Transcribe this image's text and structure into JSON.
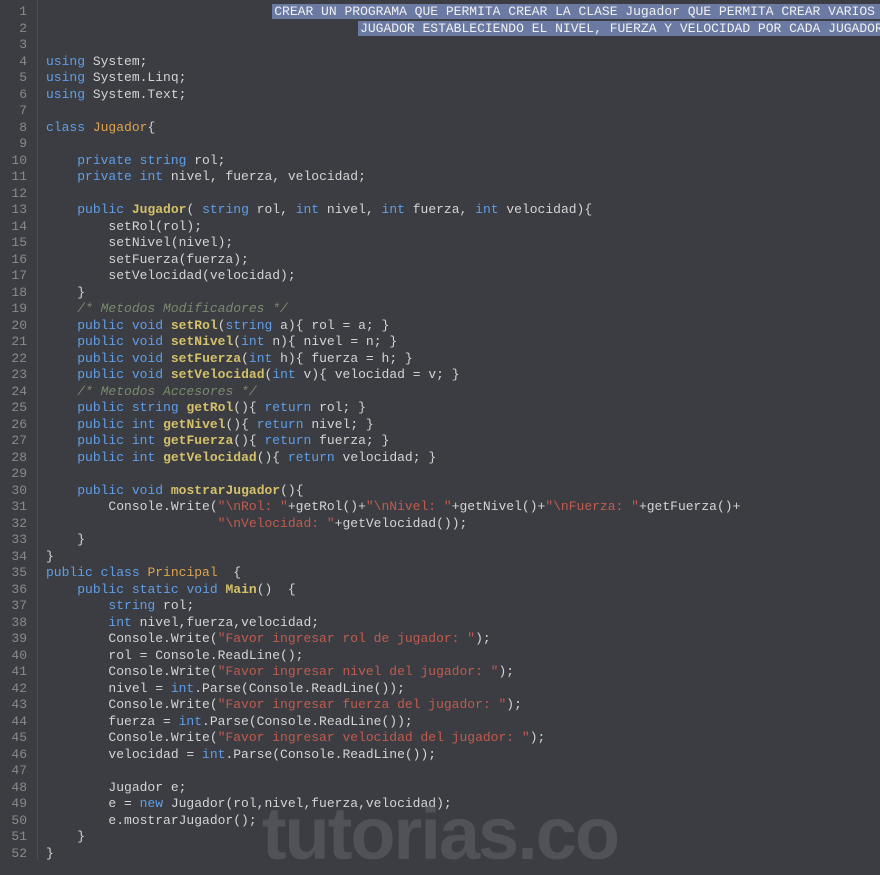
{
  "watermark": "tutorias.co",
  "selection_line1": "CREAR UN PROGRAMA QUE PERMITA CREAR LA CLASE Jugador QUE PERMITA CREAR VARIOS ROL DE",
  "selection_line2": "JUGADOR ESTABLECIENDO EL NIVEL, FUERZA Y VELOCIDAD POR CADA JUGADOR CREADO",
  "lines": [
    {
      "n": 1,
      "raw": ""
    },
    {
      "n": 2,
      "raw": ""
    },
    {
      "n": 3,
      "raw": ""
    },
    {
      "n": 4,
      "t": [
        {
          "c": "kw",
          "v": "using"
        },
        {
          "c": "txt",
          "v": " System;"
        }
      ]
    },
    {
      "n": 5,
      "t": [
        {
          "c": "kw",
          "v": "using"
        },
        {
          "c": "txt",
          "v": " System.Linq;"
        }
      ]
    },
    {
      "n": 6,
      "t": [
        {
          "c": "kw",
          "v": "using"
        },
        {
          "c": "txt",
          "v": " System.Text;"
        }
      ]
    },
    {
      "n": 7,
      "raw": ""
    },
    {
      "n": 8,
      "t": [
        {
          "c": "kw",
          "v": "class"
        },
        {
          "c": "txt",
          "v": " "
        },
        {
          "c": "cls",
          "v": "Jugador"
        },
        {
          "c": "txt",
          "v": "{"
        }
      ]
    },
    {
      "n": 9,
      "raw": ""
    },
    {
      "n": 10,
      "t": [
        {
          "c": "txt",
          "v": "    "
        },
        {
          "c": "kw",
          "v": "private"
        },
        {
          "c": "txt",
          "v": " "
        },
        {
          "c": "type",
          "v": "string"
        },
        {
          "c": "txt",
          "v": " rol;"
        }
      ]
    },
    {
      "n": 11,
      "t": [
        {
          "c": "txt",
          "v": "    "
        },
        {
          "c": "kw",
          "v": "private"
        },
        {
          "c": "txt",
          "v": " "
        },
        {
          "c": "type",
          "v": "int"
        },
        {
          "c": "txt",
          "v": " nivel, fuerza, velocidad;"
        }
      ]
    },
    {
      "n": 12,
      "raw": ""
    },
    {
      "n": 13,
      "t": [
        {
          "c": "txt",
          "v": "    "
        },
        {
          "c": "kw",
          "v": "public"
        },
        {
          "c": "txt",
          "v": " "
        },
        {
          "c": "fn",
          "v": "Jugador"
        },
        {
          "c": "txt",
          "v": "( "
        },
        {
          "c": "type",
          "v": "string"
        },
        {
          "c": "txt",
          "v": " rol, "
        },
        {
          "c": "type",
          "v": "int"
        },
        {
          "c": "txt",
          "v": " nivel, "
        },
        {
          "c": "type",
          "v": "int"
        },
        {
          "c": "txt",
          "v": " fuerza, "
        },
        {
          "c": "type",
          "v": "int"
        },
        {
          "c": "txt",
          "v": " velocidad){"
        }
      ]
    },
    {
      "n": 14,
      "t": [
        {
          "c": "txt",
          "v": "        setRol(rol);"
        }
      ]
    },
    {
      "n": 15,
      "t": [
        {
          "c": "txt",
          "v": "        setNivel(nivel);"
        }
      ]
    },
    {
      "n": 16,
      "t": [
        {
          "c": "txt",
          "v": "        setFuerza(fuerza);"
        }
      ]
    },
    {
      "n": 17,
      "t": [
        {
          "c": "txt",
          "v": "        setVelocidad(velocidad);"
        }
      ]
    },
    {
      "n": 18,
      "t": [
        {
          "c": "txt",
          "v": "    }"
        }
      ]
    },
    {
      "n": 19,
      "t": [
        {
          "c": "txt",
          "v": "    "
        },
        {
          "c": "cmt",
          "v": "/* Metodos Modificadores */"
        }
      ]
    },
    {
      "n": 20,
      "t": [
        {
          "c": "txt",
          "v": "    "
        },
        {
          "c": "kw",
          "v": "public"
        },
        {
          "c": "txt",
          "v": " "
        },
        {
          "c": "type",
          "v": "void"
        },
        {
          "c": "txt",
          "v": " "
        },
        {
          "c": "fn",
          "v": "setRol"
        },
        {
          "c": "txt",
          "v": "("
        },
        {
          "c": "type",
          "v": "string"
        },
        {
          "c": "txt",
          "v": " a){ rol = a; }"
        }
      ]
    },
    {
      "n": 21,
      "t": [
        {
          "c": "txt",
          "v": "    "
        },
        {
          "c": "kw",
          "v": "public"
        },
        {
          "c": "txt",
          "v": " "
        },
        {
          "c": "type",
          "v": "void"
        },
        {
          "c": "txt",
          "v": " "
        },
        {
          "c": "fn",
          "v": "setNivel"
        },
        {
          "c": "txt",
          "v": "("
        },
        {
          "c": "type",
          "v": "int"
        },
        {
          "c": "txt",
          "v": " n){ nivel = n; }"
        }
      ]
    },
    {
      "n": 22,
      "t": [
        {
          "c": "txt",
          "v": "    "
        },
        {
          "c": "kw",
          "v": "public"
        },
        {
          "c": "txt",
          "v": " "
        },
        {
          "c": "type",
          "v": "void"
        },
        {
          "c": "txt",
          "v": " "
        },
        {
          "c": "fn",
          "v": "setFuerza"
        },
        {
          "c": "txt",
          "v": "("
        },
        {
          "c": "type",
          "v": "int"
        },
        {
          "c": "txt",
          "v": " h){ fuerza = h; }"
        }
      ]
    },
    {
      "n": 23,
      "t": [
        {
          "c": "txt",
          "v": "    "
        },
        {
          "c": "kw",
          "v": "public"
        },
        {
          "c": "txt",
          "v": " "
        },
        {
          "c": "type",
          "v": "void"
        },
        {
          "c": "txt",
          "v": " "
        },
        {
          "c": "fn",
          "v": "setVelocidad"
        },
        {
          "c": "txt",
          "v": "("
        },
        {
          "c": "type",
          "v": "int"
        },
        {
          "c": "txt",
          "v": " v){ velocidad = v; }"
        }
      ]
    },
    {
      "n": 24,
      "t": [
        {
          "c": "txt",
          "v": "    "
        },
        {
          "c": "cmt",
          "v": "/* Metodos Accesores */"
        }
      ]
    },
    {
      "n": 25,
      "t": [
        {
          "c": "txt",
          "v": "    "
        },
        {
          "c": "kw",
          "v": "public"
        },
        {
          "c": "txt",
          "v": " "
        },
        {
          "c": "type",
          "v": "string"
        },
        {
          "c": "txt",
          "v": " "
        },
        {
          "c": "fn",
          "v": "getRol"
        },
        {
          "c": "txt",
          "v": "(){ "
        },
        {
          "c": "kw",
          "v": "return"
        },
        {
          "c": "txt",
          "v": " rol; }"
        }
      ]
    },
    {
      "n": 26,
      "t": [
        {
          "c": "txt",
          "v": "    "
        },
        {
          "c": "kw",
          "v": "public"
        },
        {
          "c": "txt",
          "v": " "
        },
        {
          "c": "type",
          "v": "int"
        },
        {
          "c": "txt",
          "v": " "
        },
        {
          "c": "fn",
          "v": "getNivel"
        },
        {
          "c": "txt",
          "v": "(){ "
        },
        {
          "c": "kw",
          "v": "return"
        },
        {
          "c": "txt",
          "v": " nivel; }"
        }
      ]
    },
    {
      "n": 27,
      "t": [
        {
          "c": "txt",
          "v": "    "
        },
        {
          "c": "kw",
          "v": "public"
        },
        {
          "c": "txt",
          "v": " "
        },
        {
          "c": "type",
          "v": "int"
        },
        {
          "c": "txt",
          "v": " "
        },
        {
          "c": "fn",
          "v": "getFuerza"
        },
        {
          "c": "txt",
          "v": "(){ "
        },
        {
          "c": "kw",
          "v": "return"
        },
        {
          "c": "txt",
          "v": " fuerza; }"
        }
      ]
    },
    {
      "n": 28,
      "t": [
        {
          "c": "txt",
          "v": "    "
        },
        {
          "c": "kw",
          "v": "public"
        },
        {
          "c": "txt",
          "v": " "
        },
        {
          "c": "type",
          "v": "int"
        },
        {
          "c": "txt",
          "v": " "
        },
        {
          "c": "fn",
          "v": "getVelocidad"
        },
        {
          "c": "txt",
          "v": "(){ "
        },
        {
          "c": "kw",
          "v": "return"
        },
        {
          "c": "txt",
          "v": " velocidad; }"
        }
      ]
    },
    {
      "n": 29,
      "raw": ""
    },
    {
      "n": 30,
      "t": [
        {
          "c": "txt",
          "v": "    "
        },
        {
          "c": "kw",
          "v": "public"
        },
        {
          "c": "txt",
          "v": " "
        },
        {
          "c": "type",
          "v": "void"
        },
        {
          "c": "txt",
          "v": " "
        },
        {
          "c": "fn",
          "v": "mostrarJugador"
        },
        {
          "c": "txt",
          "v": "(){"
        }
      ]
    },
    {
      "n": 31,
      "t": [
        {
          "c": "txt",
          "v": "        Console.Write("
        },
        {
          "c": "str",
          "v": "\"\\nRol: \""
        },
        {
          "c": "txt",
          "v": "+getRol()+"
        },
        {
          "c": "str",
          "v": "\"\\nNivel: \""
        },
        {
          "c": "txt",
          "v": "+getNivel()+"
        },
        {
          "c": "str",
          "v": "\"\\nFuerza: \""
        },
        {
          "c": "txt",
          "v": "+getFuerza()+"
        }
      ]
    },
    {
      "n": 32,
      "t": [
        {
          "c": "txt",
          "v": "                      "
        },
        {
          "c": "str",
          "v": "\"\\nVelocidad: \""
        },
        {
          "c": "txt",
          "v": "+getVelocidad());"
        }
      ]
    },
    {
      "n": 33,
      "t": [
        {
          "c": "txt",
          "v": "    }"
        }
      ]
    },
    {
      "n": 34,
      "t": [
        {
          "c": "txt",
          "v": "}"
        }
      ]
    },
    {
      "n": 35,
      "t": [
        {
          "c": "kw",
          "v": "public"
        },
        {
          "c": "txt",
          "v": " "
        },
        {
          "c": "kw",
          "v": "class"
        },
        {
          "c": "txt",
          "v": " "
        },
        {
          "c": "cls",
          "v": "Principal"
        },
        {
          "c": "txt",
          "v": "  {"
        }
      ]
    },
    {
      "n": 36,
      "t": [
        {
          "c": "txt",
          "v": "    "
        },
        {
          "c": "kw",
          "v": "public"
        },
        {
          "c": "txt",
          "v": " "
        },
        {
          "c": "kw",
          "v": "static"
        },
        {
          "c": "txt",
          "v": " "
        },
        {
          "c": "type",
          "v": "void"
        },
        {
          "c": "txt",
          "v": " "
        },
        {
          "c": "fn",
          "v": "Main"
        },
        {
          "c": "txt",
          "v": "()  {"
        }
      ]
    },
    {
      "n": 37,
      "t": [
        {
          "c": "txt",
          "v": "        "
        },
        {
          "c": "type",
          "v": "string"
        },
        {
          "c": "txt",
          "v": " rol;"
        }
      ]
    },
    {
      "n": 38,
      "t": [
        {
          "c": "txt",
          "v": "        "
        },
        {
          "c": "type",
          "v": "int"
        },
        {
          "c": "txt",
          "v": " nivel,fuerza,velocidad;"
        }
      ]
    },
    {
      "n": 39,
      "t": [
        {
          "c": "txt",
          "v": "        Console.Write("
        },
        {
          "c": "str",
          "v": "\"Favor ingresar rol de jugador: \""
        },
        {
          "c": "txt",
          "v": ");"
        }
      ]
    },
    {
      "n": 40,
      "t": [
        {
          "c": "txt",
          "v": "        rol = Console.ReadLine();"
        }
      ]
    },
    {
      "n": 41,
      "t": [
        {
          "c": "txt",
          "v": "        Console.Write("
        },
        {
          "c": "str",
          "v": "\"Favor ingresar nivel del jugador: \""
        },
        {
          "c": "txt",
          "v": ");"
        }
      ]
    },
    {
      "n": 42,
      "t": [
        {
          "c": "txt",
          "v": "        nivel = "
        },
        {
          "c": "type",
          "v": "int"
        },
        {
          "c": "txt",
          "v": ".Parse(Console.ReadLine());"
        }
      ]
    },
    {
      "n": 43,
      "t": [
        {
          "c": "txt",
          "v": "        Console.Write("
        },
        {
          "c": "str",
          "v": "\"Favor ingresar fuerza del jugador: \""
        },
        {
          "c": "txt",
          "v": ");"
        }
      ]
    },
    {
      "n": 44,
      "t": [
        {
          "c": "txt",
          "v": "        fuerza = "
        },
        {
          "c": "type",
          "v": "int"
        },
        {
          "c": "txt",
          "v": ".Parse(Console.ReadLine());"
        }
      ]
    },
    {
      "n": 45,
      "t": [
        {
          "c": "txt",
          "v": "        Console.Write("
        },
        {
          "c": "str",
          "v": "\"Favor ingresar velocidad del jugador: \""
        },
        {
          "c": "txt",
          "v": ");"
        }
      ]
    },
    {
      "n": 46,
      "t": [
        {
          "c": "txt",
          "v": "        velocidad = "
        },
        {
          "c": "type",
          "v": "int"
        },
        {
          "c": "txt",
          "v": ".Parse(Console.ReadLine());"
        }
      ]
    },
    {
      "n": 47,
      "raw": ""
    },
    {
      "n": 48,
      "t": [
        {
          "c": "txt",
          "v": "        Jugador e;"
        }
      ]
    },
    {
      "n": 49,
      "t": [
        {
          "c": "txt",
          "v": "        e = "
        },
        {
          "c": "kw",
          "v": "new"
        },
        {
          "c": "txt",
          "v": " Jugador(rol,nivel,fuerza,velocidad);"
        }
      ]
    },
    {
      "n": 50,
      "t": [
        {
          "c": "txt",
          "v": "        e.mostrarJugador();"
        }
      ]
    },
    {
      "n": 51,
      "t": [
        {
          "c": "txt",
          "v": "    }"
        }
      ]
    },
    {
      "n": 52,
      "t": [
        {
          "c": "txt",
          "v": "}"
        }
      ]
    }
  ]
}
